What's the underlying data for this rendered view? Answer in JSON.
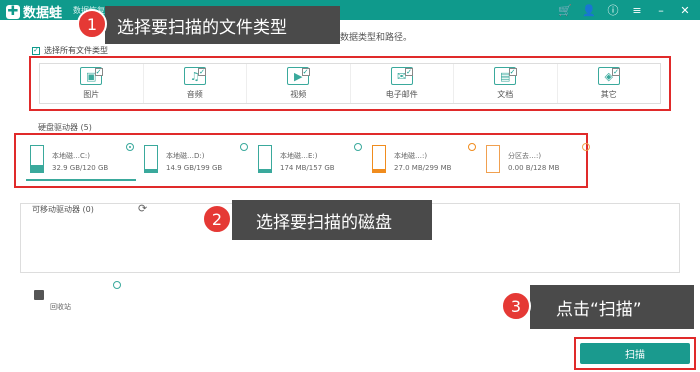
{
  "titlebar": {
    "logo": "数据蛙",
    "subtitle": "数据恢复专家（未注册）"
  },
  "hint": "选择要恢复丢失数据的数据类型和路径。",
  "select_all": "选择所有文件类型",
  "file_types": [
    {
      "label": "图片",
      "icon": "image-icon",
      "glyph": "▣"
    },
    {
      "label": "音频",
      "icon": "audio-icon",
      "glyph": "♫"
    },
    {
      "label": "视频",
      "icon": "video-icon",
      "glyph": "▶"
    },
    {
      "label": "电子邮件",
      "icon": "email-icon",
      "glyph": "✉"
    },
    {
      "label": "文档",
      "icon": "document-icon",
      "glyph": "▤"
    },
    {
      "label": "其它",
      "icon": "other-icon",
      "glyph": "◈"
    }
  ],
  "disk_section_title": "硬盘驱动器 (5)",
  "disks": [
    {
      "name": "本地磁…C:)",
      "size": "32.9 GB/120 GB",
      "used": 0.27,
      "color": "#3aa99c",
      "selected": true
    },
    {
      "name": "本地磁…D:)",
      "size": "14.9 GB/199 GB",
      "used": 0.07,
      "color": "#3aa99c",
      "selected": false
    },
    {
      "name": "本地磁…E:)",
      "size": "174 MB/157 GB",
      "used": 0.01,
      "color": "#3aa99c",
      "selected": false
    },
    {
      "name": "本地磁…:)",
      "size": "27.0 MB/299 MB",
      "used": 0.09,
      "color": "#f08c1e",
      "selected": false
    },
    {
      "name": "分区去…:)",
      "size": "0.00  B/128 MB",
      "used": 0.0,
      "color": "#f0a050",
      "selected": false
    }
  ],
  "removable_title": "可移动驱动器 (0)",
  "recycle_label": "回收站",
  "scan_button": "扫描",
  "callouts": [
    {
      "num": "1",
      "text": "选择要扫描的文件类型"
    },
    {
      "num": "2",
      "text": "选择要扫描的磁盘"
    },
    {
      "num": "3",
      "text": "点击“扫描”"
    }
  ],
  "colors": {
    "accent": "#0f9a8c",
    "highlight": "#e02a2a",
    "callout_bg": "#4a4a4a"
  }
}
